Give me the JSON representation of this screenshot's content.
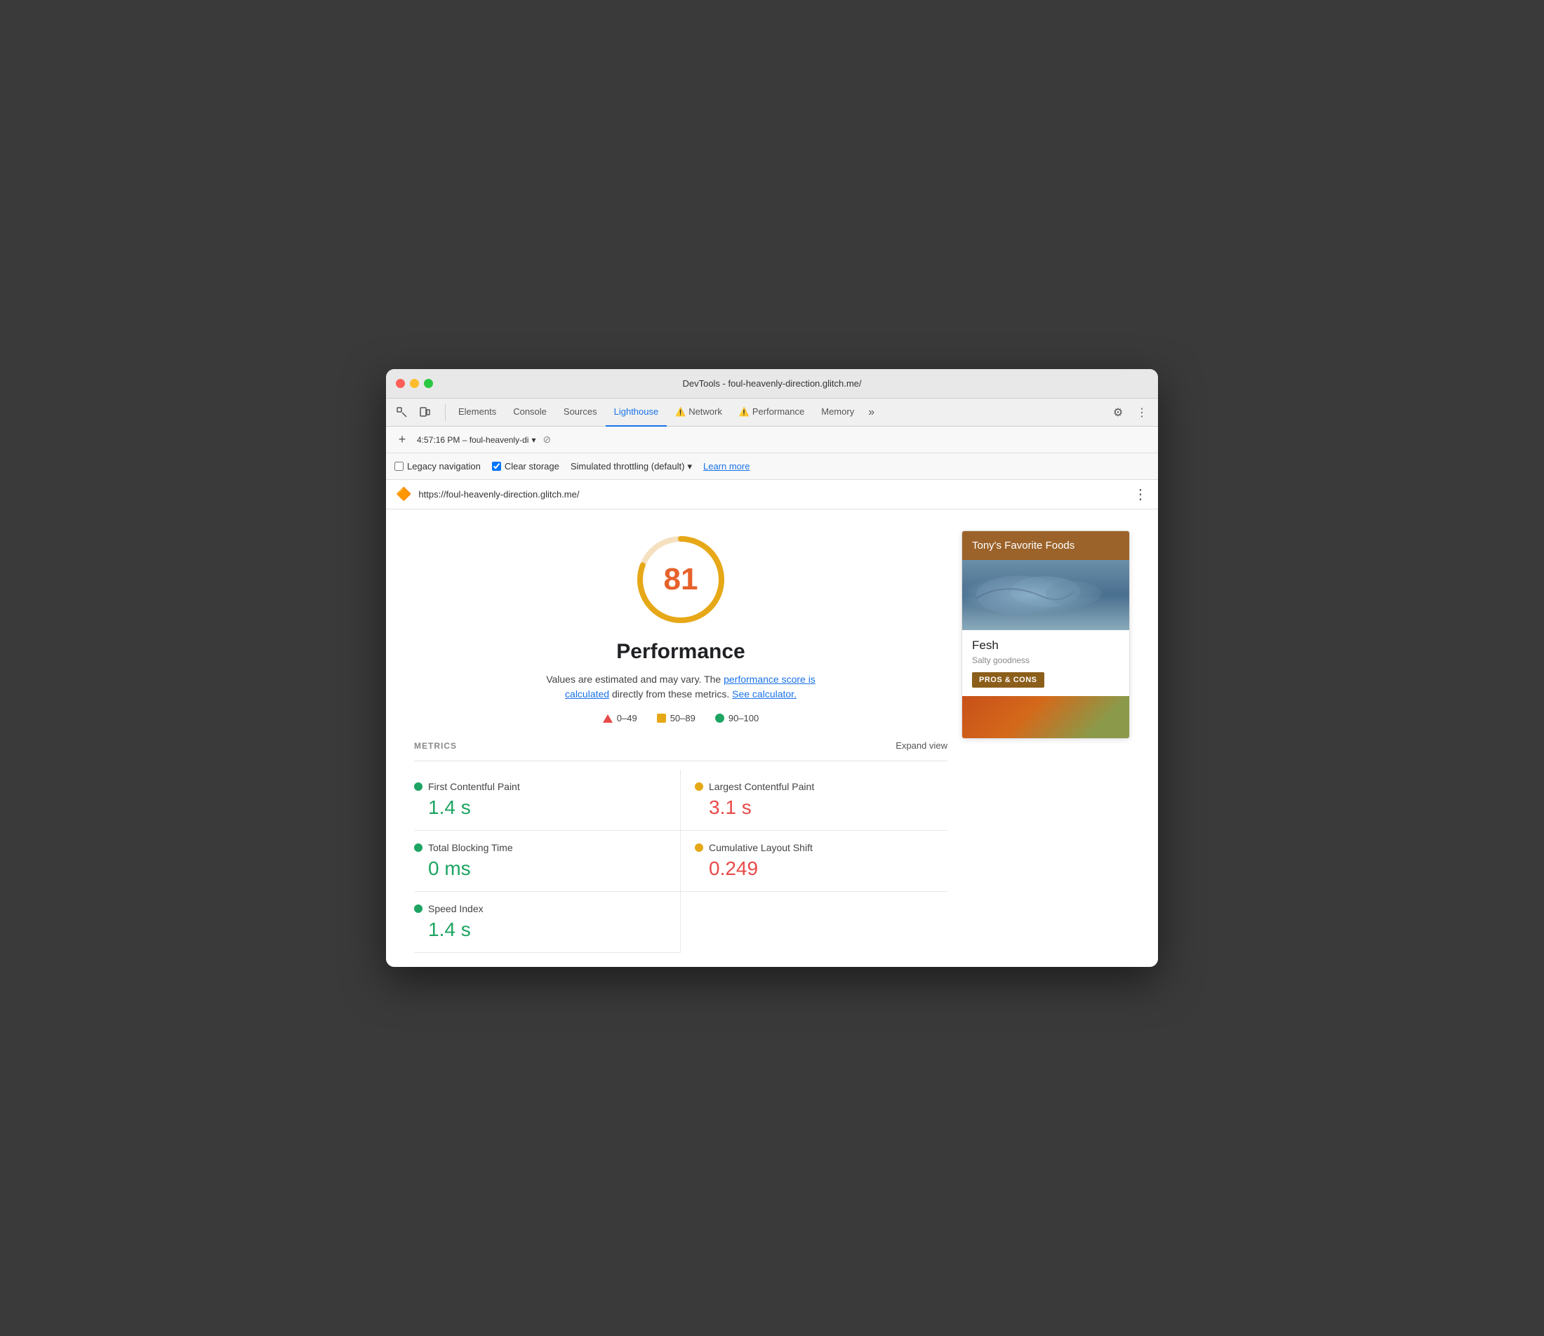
{
  "window": {
    "title": "DevTools - foul-heavenly-direction.glitch.me/"
  },
  "tabs": {
    "elements": "Elements",
    "console": "Console",
    "sources": "Sources",
    "lighthouse": "Lighthouse",
    "network": "Network",
    "performance": "Performance",
    "memory": "Memory",
    "more": "»"
  },
  "session": {
    "timestamp": "4:57:16 PM – foul-heavenly-di",
    "dropdown_arrow": "▾"
  },
  "options": {
    "legacy_nav_label": "Legacy navigation",
    "clear_storage_label": "Clear storage",
    "clear_storage_checked": true,
    "throttling_label": "Simulated throttling (default)",
    "throttling_arrow": "▾",
    "learn_more": "Learn more"
  },
  "url_bar": {
    "url": "https://foul-heavenly-direction.glitch.me/",
    "favicon": "🔶"
  },
  "score": {
    "value": "81",
    "ring_color": "#e6a817",
    "ring_bg": "#f5e0c0"
  },
  "performance": {
    "title": "Performance",
    "description_1": "Values are estimated and may vary. The ",
    "link_1": "performance score is calculated",
    "description_2": " directly from these metrics. ",
    "link_2": "See calculator.",
    "legend": {
      "range1": "0–49",
      "range2": "50–89",
      "range3": "90–100"
    }
  },
  "metrics": {
    "label": "METRICS",
    "expand_view": "Expand view",
    "items": [
      {
        "name": "First Contentful Paint",
        "value": "1.4 s",
        "color": "green"
      },
      {
        "name": "Largest Contentful Paint",
        "value": "3.1 s",
        "color": "orange"
      },
      {
        "name": "Total Blocking Time",
        "value": "0 ms",
        "color": "green"
      },
      {
        "name": "Cumulative Layout Shift",
        "value": "0.249",
        "color": "orange"
      },
      {
        "name": "Speed Index",
        "value": "1.4 s",
        "color": "green"
      }
    ]
  },
  "food_card": {
    "header": "Tony's Favorite Foods",
    "food_name": "Fesh",
    "food_desc": "Salty goodness",
    "pros_cons_btn": "PROS & CONS"
  }
}
